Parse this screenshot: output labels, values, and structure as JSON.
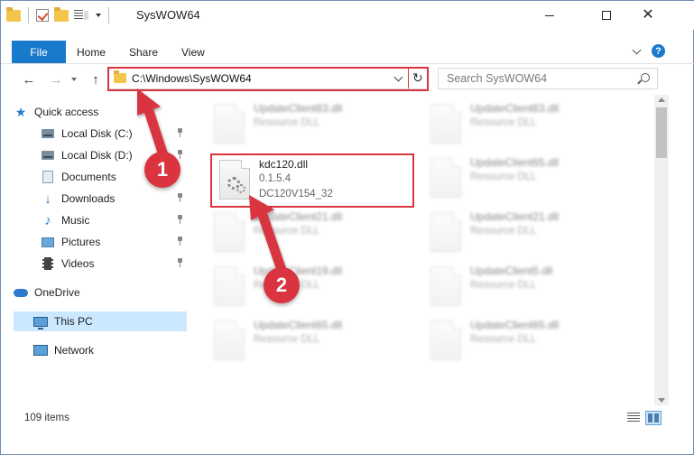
{
  "window": {
    "title": "SysWOW64"
  },
  "ribbon": {
    "tabs": [
      "File",
      "Home",
      "Share",
      "View"
    ]
  },
  "address": {
    "path": "C:\\Windows\\SysWOW64",
    "search_placeholder": "Search SysWOW64"
  },
  "sidebar": {
    "items": [
      {
        "label": "Quick access",
        "icon": "star-icon"
      },
      {
        "label": "Local Disk (C:)",
        "icon": "disk-icon"
      },
      {
        "label": "Local Disk (D:)",
        "icon": "disk-icon"
      },
      {
        "label": "Documents",
        "icon": "documents-icon"
      },
      {
        "label": "Downloads",
        "icon": "download-icon"
      },
      {
        "label": "Music",
        "icon": "music-icon"
      },
      {
        "label": "Pictures",
        "icon": "pictures-icon"
      },
      {
        "label": "Videos",
        "icon": "videos-icon"
      },
      {
        "label": "OneDrive",
        "icon": "cloud-icon"
      },
      {
        "label": "This PC",
        "icon": "computer-icon"
      },
      {
        "label": "Network",
        "icon": "network-icon"
      }
    ]
  },
  "files": {
    "kdc": {
      "name": "kdc120.dll",
      "version": "0.1.5.4",
      "description": "DC120V154_32"
    },
    "others": [
      {
        "name": "UpdateClient63.dll",
        "desc": "Resource DLL"
      },
      {
        "name": "UpdateClient63.dll",
        "desc": "Resource DLL"
      },
      {
        "name": "UpdateClient65.dll",
        "desc": "Resource DLL"
      },
      {
        "name": "UpdateClient21.dll",
        "desc": "Resource DLL"
      },
      {
        "name": "UpdateClient21.dll",
        "desc": "Resource DLL"
      },
      {
        "name": "UpdateClient19.dll",
        "desc": "Resource DLL"
      },
      {
        "name": "UpdateClient5.dll",
        "desc": "Resource DLL"
      },
      {
        "name": "UpdateClient65.dll",
        "desc": "Resource DLL"
      },
      {
        "name": "UpdateClient65.dll",
        "desc": "Resource DLL"
      }
    ]
  },
  "status": {
    "item_count": "109 items"
  },
  "callouts": [
    "1",
    "2"
  ],
  "colors": {
    "accent": "#1979ca",
    "highlight": "#d9343f",
    "selected": "#cce8ff"
  }
}
